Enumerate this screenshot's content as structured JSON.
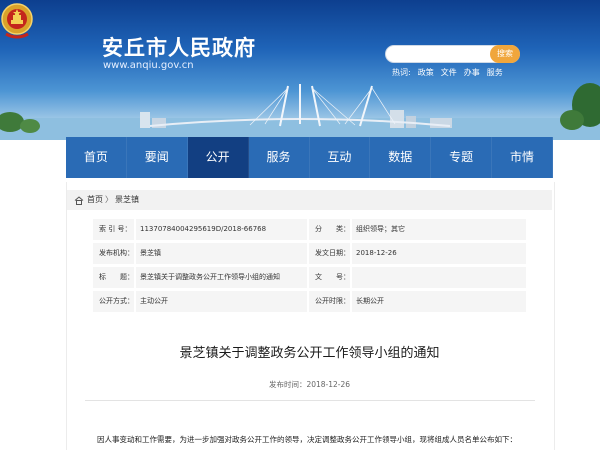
{
  "header": {
    "site_title": "安丘市人民政府",
    "site_url": "www.anqiu.gov.cn",
    "search": {
      "placeholder": "",
      "button_label": "搜索"
    },
    "hot_label": "热词:",
    "hot_words": [
      "政策",
      "文件",
      "办事",
      "服务"
    ]
  },
  "nav": {
    "items": [
      {
        "label": "首页"
      },
      {
        "label": "要闻"
      },
      {
        "label": "公开"
      },
      {
        "label": "服务"
      },
      {
        "label": "互动"
      },
      {
        "label": "数据"
      },
      {
        "label": "专题"
      },
      {
        "label": "市情"
      }
    ],
    "active_index": 2
  },
  "breadcrumb": {
    "home": "首页",
    "separator": "〉",
    "current": "景芝镇"
  },
  "meta": {
    "rows": [
      {
        "l1": "索 引 号：",
        "v1": "11370784004295619D/2018-66768",
        "l2": "分　　类：",
        "v2": "组织领导；其它"
      },
      {
        "l1": "发布机构：",
        "v1": "景芝镇",
        "l2": "发文日期：",
        "v2": "2018-12-26"
      },
      {
        "l1": "标　　题：",
        "v1": "景芝镇关于调整政务公开工作领导小组的通知",
        "l2": "文　　号：",
        "v2": ""
      },
      {
        "l1": "公开方式：",
        "v1": "主动公开",
        "l2": "公开时限：",
        "v2": "长期公开"
      }
    ]
  },
  "document": {
    "title": "景芝镇关于调整政务公开工作领导小组的通知",
    "publish_time": "发布时间：2018-12-26",
    "body_first_line": "因人事变动和工作需要，为进一步加强对政务公开工作的领导，决定调整政务公开工作领导小组，现将组成人员名单公布如下："
  },
  "colors": {
    "nav_bg": "#2a6bb5",
    "nav_active": "#123f82",
    "search_button": "#f0a63c",
    "banner_top": "#0d3f8f"
  },
  "icons": {
    "emblem": "national-emblem-icon",
    "home": "home-icon"
  }
}
